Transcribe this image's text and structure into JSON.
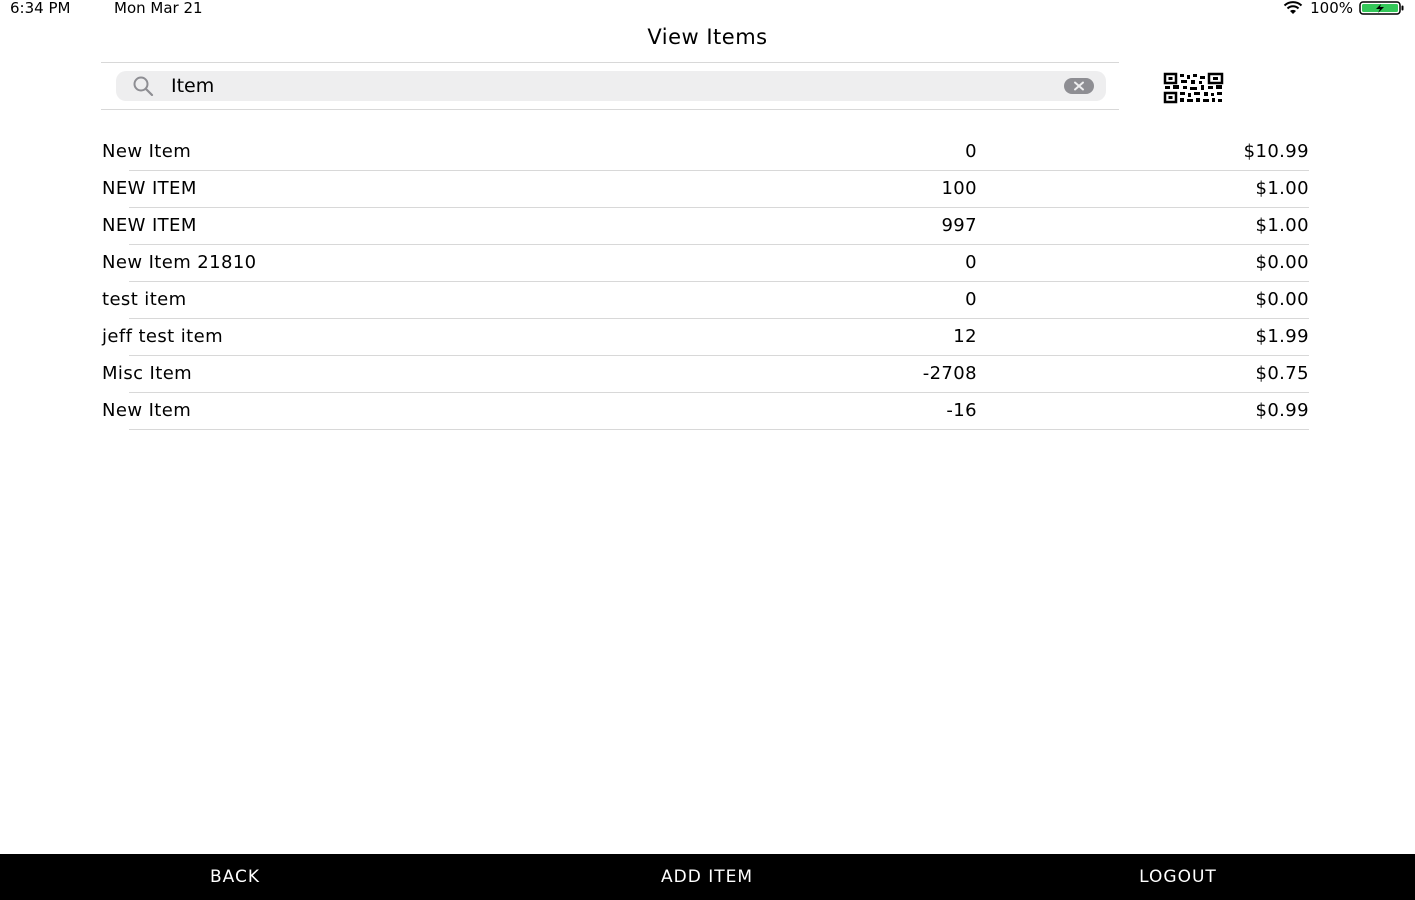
{
  "status_bar": {
    "time": "6:34 PM",
    "date": "Mon Mar 21",
    "battery": "100%",
    "icons": [
      "wifi-icon",
      "battery-charging-icon"
    ]
  },
  "header": {
    "title": "View Items"
  },
  "search": {
    "value": "Item",
    "icons": [
      "search-icon",
      "clear-icon"
    ]
  },
  "qr_icon": "qr-code-icon",
  "items": [
    {
      "name": "New Item",
      "qty": "0",
      "price": "$10.99"
    },
    {
      "name": "NEW ITEM",
      "qty": "100",
      "price": "$1.00"
    },
    {
      "name": "NEW ITEM",
      "qty": "997",
      "price": "$1.00"
    },
    {
      "name": "New Item 21810",
      "qty": "0",
      "price": "$0.00"
    },
    {
      "name": "test item",
      "qty": "0",
      "price": "$0.00"
    },
    {
      "name": "jeff test item",
      "qty": "12",
      "price": "$1.99"
    },
    {
      "name": "Misc Item",
      "qty": "-2708",
      "price": "$0.75"
    },
    {
      "name": "New Item",
      "qty": "-16",
      "price": "$0.99"
    }
  ],
  "bottom_bar": {
    "back_label": "BACK",
    "add_label": "ADD ITEM",
    "logout_label": "LOGOUT"
  },
  "colors": {
    "battery_fill": "#34c759",
    "bottom_bar_bg": "#000000",
    "search_bg": "#eeeeef",
    "divider": "#d8d8d8"
  }
}
